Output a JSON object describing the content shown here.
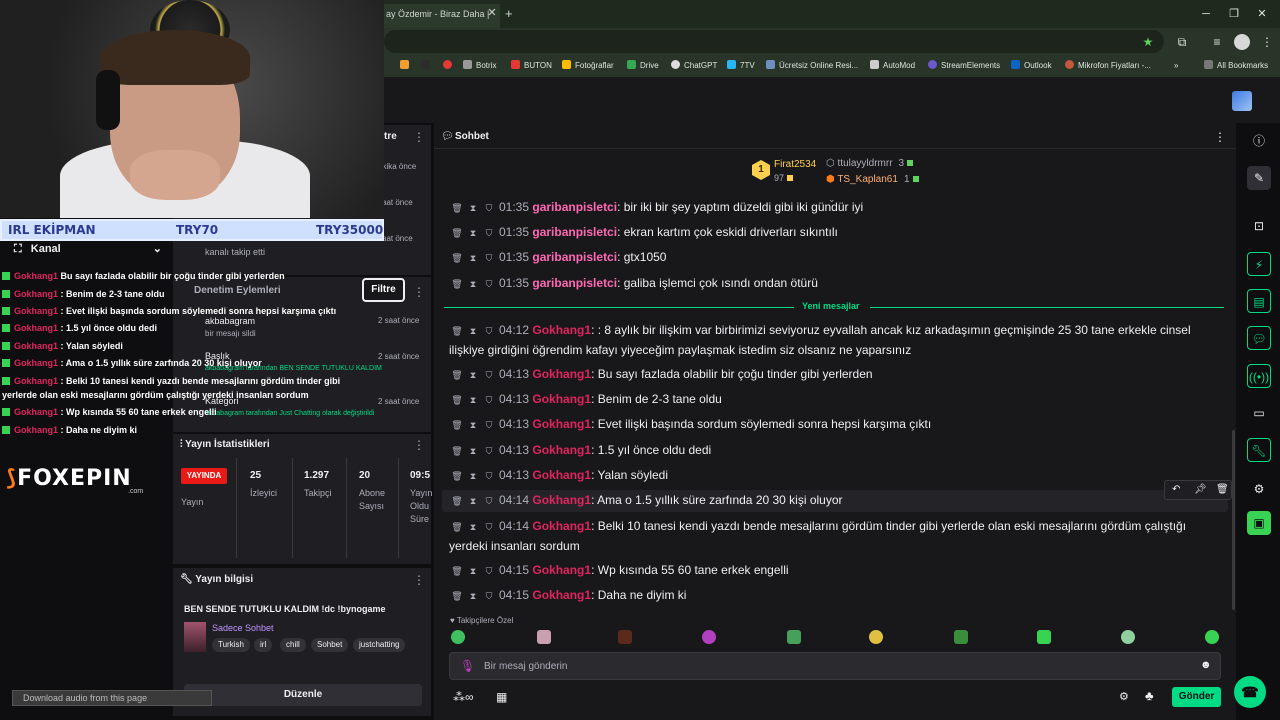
{
  "browser": {
    "tab_title": "ay Özdemir - Biraz Daha |",
    "bookmarks": [
      "Botrix",
      "BUTON",
      "Fotoğraflar",
      "Drive",
      "ChatGPT",
      "7TV",
      "Ücretsiz Online Resi...",
      "AutoMod",
      "StreamElements",
      "Outlook",
      "Mikrofon Fiyatları -...",
      "All Bookmarks"
    ]
  },
  "overlay": {
    "price_bar": {
      "left": "IRL EKİPMAN",
      "mid": "TRY70",
      "right": "TRY35000"
    },
    "chat": [
      {
        "user": "Gokhang1",
        "text": " Bu sayı fazlada olabilir bir çoğu tinder gibi yerlerden"
      },
      {
        "user": "Gokhang1",
        "text": " : Benim de 2-3 tane oldu"
      },
      {
        "user": "Gokhang1",
        "text": " : Evet ilişki başında sordum söylemedi sonra hepsi karşıma çıktı"
      },
      {
        "user": "Gokhang1",
        "text": " : 1.5 yıl önce oldu dedi"
      },
      {
        "user": "Gokhang1",
        "text": " : Yalan söyledi"
      },
      {
        "user": "Gokhang1",
        "text": " : Ama o 1.5 yıllık süre zarfında 20 30 kişi oluyor"
      },
      {
        "user": "Gokhang1",
        "text": " : Belki 10 tanesi kendi yazdı bende mesajlarını gördüm tinder gibi"
      },
      {
        "user": "",
        "text": "yerlerde olan eski mesajlarını gördüm çalıştığı yerdeki insanları sordum"
      },
      {
        "user": "Gokhang1",
        "text": " : Wp kısında 55 60 tane erkek engelli"
      },
      {
        "user": "Gokhang1",
        "text": " : Daha ne diyim ki"
      }
    ],
    "sponsor": "FOXEPIN",
    "sponsor_domain": ".com",
    "download_audio": "Download audio from this page"
  },
  "dashboard": {
    "kanal": "Kanal",
    "activity_title": "tre",
    "activity": [
      {
        "text": "",
        "time": "akika önce"
      },
      {
        "text": "",
        "time": "saat önce"
      },
      {
        "text": "kanalı takip etti",
        "time": "saat önce"
      }
    ],
    "mod_actions_title": "Denetim Eylemleri",
    "filter_label": "Filtre",
    "mod_rows": [
      {
        "title": "akbabagram",
        "sub": "bir mesajı sildi",
        "time": "2 saat önce"
      },
      {
        "title": "Başlık",
        "sub": "akbabagram tarafından BEN SENDE TUTUKLU KALDIM",
        "time": "2 saat önce"
      },
      {
        "title": "Kategori",
        "sub": "akbabagram tarafından Just Chatting olarak değiştirildi",
        "time": "2 saat önce"
      }
    ],
    "stats_title": "Yayın İstatistikleri",
    "stats": {
      "live_label": "YAYINDA",
      "live_sub": "Yayın",
      "viewers": "25",
      "viewers_lbl": "İzleyici",
      "followers": "1.297",
      "followers_lbl": "Takipçi",
      "subs": "20",
      "subs_lbl": "Abone Sayısı",
      "duration": "09:5",
      "duration_lbl": "Yayın Oldu Süre"
    },
    "info_title": "Yayın bilgisi",
    "stream_title": "BEN SENDE TUTUKLU KALDIM !dc !bynogame",
    "category": "Sadece Sohbet",
    "tags": [
      "Turkish",
      "irl",
      "chill",
      "Sohbet",
      "justchatting"
    ],
    "edit_label": "Düzenle"
  },
  "chat": {
    "title": "Sohbet",
    "leaderboard": {
      "top_user": "Firat2534",
      "top_score": "97",
      "rank": "1",
      "gift_users": [
        {
          "name": "ttulayyldrmrr",
          "count": "3"
        },
        {
          "name": "TS_Kaplan61",
          "count": "1"
        }
      ]
    },
    "messages_old": [
      {
        "time": "01:35",
        "user": "garibanpisletci",
        "text": " bir iki bir şey yaptım düzeldi gibi iki gündür iyi"
      },
      {
        "time": "01:35",
        "user": "garibanpisletci",
        "text": " ekran kartım çok eskidi driverları sıkıntılı"
      },
      {
        "time": "01:35",
        "user": "garibanpisletci",
        "text": " gtx1050"
      },
      {
        "time": "01:35",
        "user": "garibanpisletci",
        "text": " galiba işlemci çok ısındı ondan ötürü"
      }
    ],
    "new_messages_label": "Yeni mesajlar",
    "messages_new": [
      {
        "time": "04:12",
        "user": "Gokhang1",
        "text": " : 8 aylık bir ilişkim var birbirimizi seviyoruz eyvallah ancak kız arkadaşımın geçmişinde 25 30 tane erkekle cinsel ilişkiye girdiğini öğrendim kafayı yiyeceğim paylaşmak istedim siz olsanız ne yaparsınız"
      },
      {
        "time": "04:13",
        "user": "Gokhang1",
        "text": " Bu sayı fazlada olabilir bir çoğu tinder gibi yerlerden"
      },
      {
        "time": "04:13",
        "user": "Gokhang1",
        "text": " Benim de 2-3 tane oldu"
      },
      {
        "time": "04:13",
        "user": "Gokhang1",
        "text": " Evet ilişki başında sordum söylemedi sonra hepsi karşıma çıktı"
      },
      {
        "time": "04:13",
        "user": "Gokhang1",
        "text": " 1.5 yıl önce oldu dedi"
      },
      {
        "time": "04:13",
        "user": "Gokhang1",
        "text": " Yalan söyledi"
      },
      {
        "time": "04:14",
        "user": "Gokhang1",
        "text": " Ama o 1.5 yıllık süre zarfında 20 30 kişi oluyor"
      },
      {
        "time": "04:14",
        "user": "Gokhang1",
        "text": " Belki 10 tanesi kendi yazdı bende mesajlarını gördüm tinder gibi yerlerde olan eski mesajlarını gördüm çalıştığı yerdeki insanları sordum"
      },
      {
        "time": "04:15",
        "user": "Gokhang1",
        "text": " Wp kısında 55 60 tane erkek engelli"
      },
      {
        "time": "04:15",
        "user": "Gokhang1",
        "text": " Daha ne diyim ki"
      }
    ],
    "followers_only": "Takipçilere Özel",
    "input_placeholder": "Bir mesaj gönderin",
    "send_label": "Gönder"
  },
  "colors": {
    "accent": "#00db84",
    "username_red": "#e0245e",
    "username_pink": "#ff69b4",
    "live": "#e91916"
  }
}
